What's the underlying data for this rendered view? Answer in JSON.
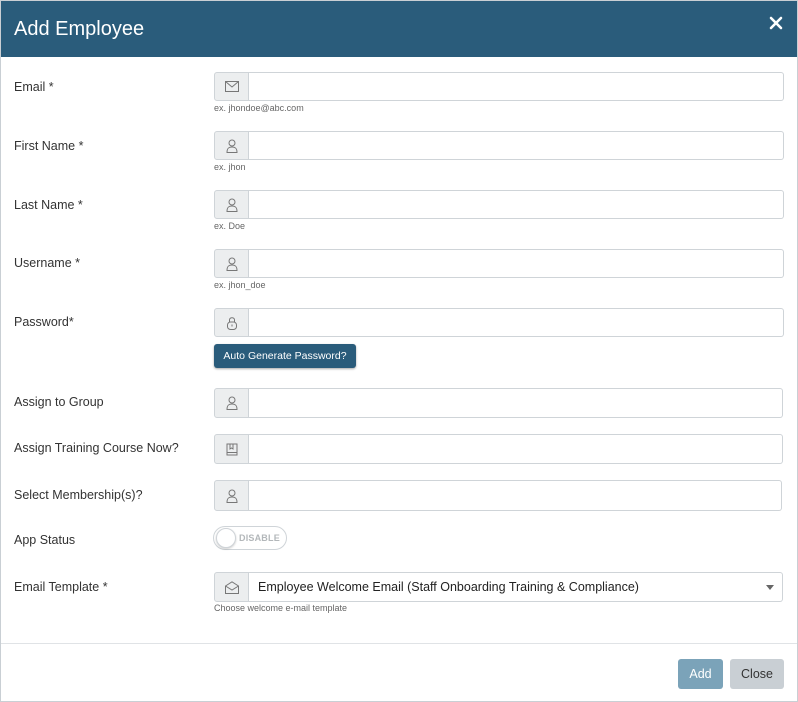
{
  "modal": {
    "title": "Add Employee"
  },
  "fields": {
    "email": {
      "label": "Email *",
      "value": "",
      "placeholder": "",
      "hint": "ex. jhondoe@abc.com"
    },
    "first_name": {
      "label": "First Name *",
      "value": "",
      "placeholder": "",
      "hint": "ex. jhon"
    },
    "last_name": {
      "label": "Last Name *",
      "value": "",
      "placeholder": "",
      "hint": "ex. Doe"
    },
    "username": {
      "label": "Username *",
      "value": "",
      "placeholder": "",
      "hint": "ex. jhon_doe"
    },
    "password": {
      "label": "Password*",
      "value": "",
      "placeholder": "",
      "generate_label": "Auto Generate Password?"
    },
    "group": {
      "label": "Assign to Group",
      "value": "",
      "placeholder": ""
    },
    "training": {
      "label": "Assign Training Course Now?",
      "value": "",
      "placeholder": ""
    },
    "membership": {
      "label": "Select Membership(s)?",
      "value": "",
      "placeholder": ""
    },
    "app_status": {
      "label": "App Status",
      "toggle_text": "DISABLE",
      "enabled": false
    },
    "email_template": {
      "label": "Email Template *",
      "selected": "Employee Welcome Email (Staff Onboarding Training & Compliance)",
      "hint": "Choose welcome e-mail template"
    }
  },
  "footer": {
    "add_label": "Add",
    "close_label": "Close"
  },
  "icons": {
    "email_field": "envelope-icon",
    "first_name_field": "user-icon",
    "last_name_field": "user-icon",
    "username_field": "user-icon",
    "password_field": "lock-icon",
    "group_field": "user-icon",
    "training_field": "book-icon",
    "membership_field": "user-icon",
    "template_field": "envelope-open-icon",
    "close": "close-icon"
  },
  "colors": {
    "header": "#2a5c7b",
    "primary_button": "#2a5c7b",
    "add_button": "#7ba3b9",
    "close_button": "#c9cfd4"
  }
}
